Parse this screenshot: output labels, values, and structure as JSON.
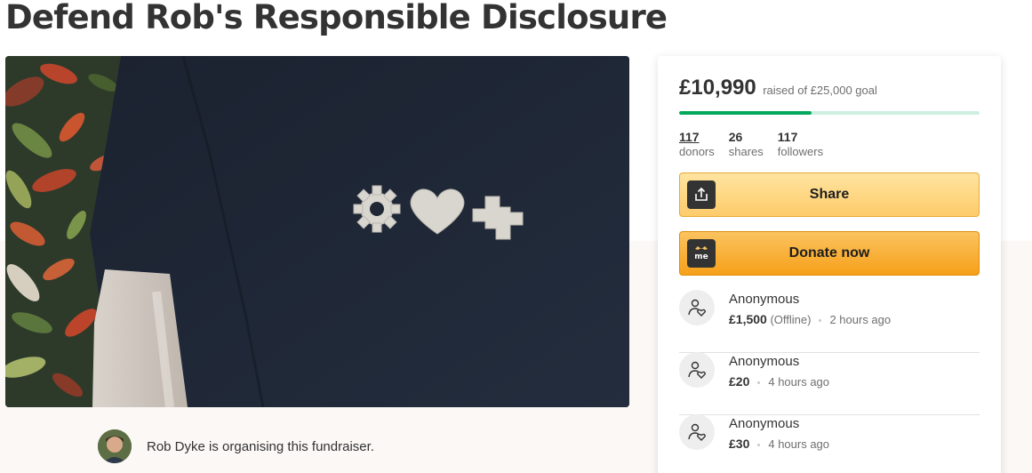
{
  "campaign": {
    "title": "Defend Rob's Responsible Disclosure",
    "organiser_text": "Rob Dyke is organising this fundraiser."
  },
  "funding": {
    "raised": "£10,990",
    "goal_text": "raised of £25,000 goal",
    "progress_fraction": 0.44,
    "progress_color": "#02a95c"
  },
  "stats": [
    {
      "value": "117",
      "label": "donors"
    },
    {
      "value": "26",
      "label": "shares"
    },
    {
      "value": "117",
      "label": "followers"
    }
  ],
  "buttons": {
    "share_label": "Share",
    "donate_label": "Donate now",
    "donate_icon_text": "me"
  },
  "donations": [
    {
      "name": "Anonymous",
      "amount": "£1,500",
      "note": "(Offline)",
      "time": "2 hours ago"
    },
    {
      "name": "Anonymous",
      "amount": "£20",
      "note": "",
      "time": "4 hours ago"
    },
    {
      "name": "Anonymous",
      "amount": "£30",
      "note": "",
      "time": "4 hours ago"
    }
  ],
  "icons": {
    "share": "upload-icon",
    "donate": "gofundme-logo-icon",
    "donor": "user-heart-icon"
  }
}
